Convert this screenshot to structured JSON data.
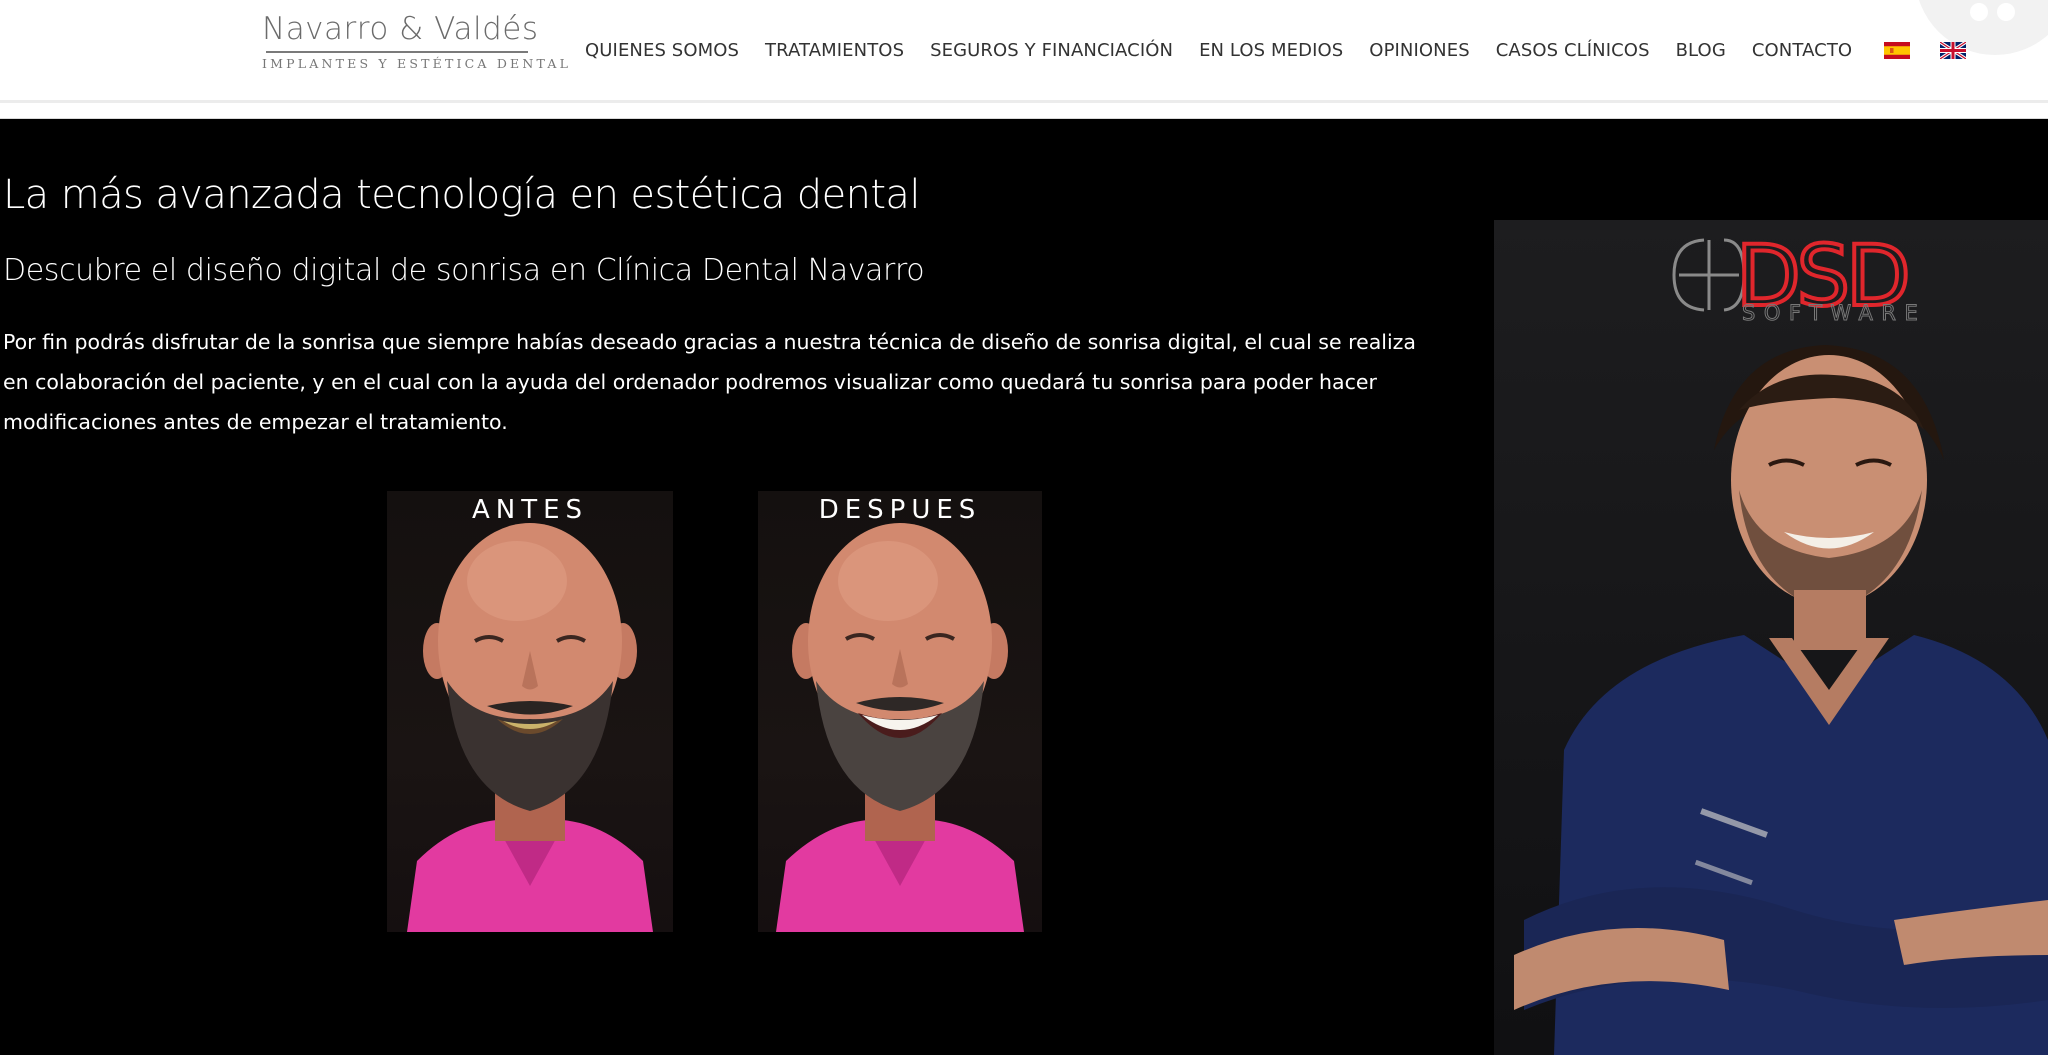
{
  "logo": {
    "name": "Navarro & Valdés",
    "tagline": "IMPLANTES Y ESTÉTICA DENTAL"
  },
  "nav": {
    "items": [
      {
        "label": "QUIENES SOMOS"
      },
      {
        "label": "TRATAMIENTOS"
      },
      {
        "label": "SEGUROS Y FINANCIACIÓN"
      },
      {
        "label": "EN LOS MEDIOS"
      },
      {
        "label": "OPINIONES"
      },
      {
        "label": "CASOS CLÍNICOS"
      },
      {
        "label": "BLOG"
      },
      {
        "label": "CONTACTO"
      }
    ],
    "languages": [
      {
        "icon": "spain-flag-icon"
      },
      {
        "icon": "uk-flag-icon"
      }
    ]
  },
  "hero": {
    "title": "La más avanzada tecnología en estética dental",
    "subtitle": "Descubre el diseño digital de sonrisa en Clínica Dental Navarro",
    "body": "Por fin podrás disfrutar de la sonrisa que siempre habías deseado gracias a nuestra técnica de diseño de sonrisa digital, el cual se realiza en colaboración del paciente, y en el cual con la ayuda del ordenador podremos visualizar como quedará tu sonrisa para poder hacer modificaciones antes de empezar el tratamiento."
  },
  "comparison": {
    "before_label": "ANTES",
    "after_label": "DESPUES"
  },
  "promo": {
    "brand": "DSD",
    "brand_sub": "SOFTWARE"
  },
  "colors": {
    "background": "#000000",
    "header_bg": "#ffffff",
    "nav_text": "#333333",
    "dsd_red": "#e0262c",
    "shirt_pink": "#e23aa0",
    "scrubs_navy": "#1c2a5e"
  }
}
